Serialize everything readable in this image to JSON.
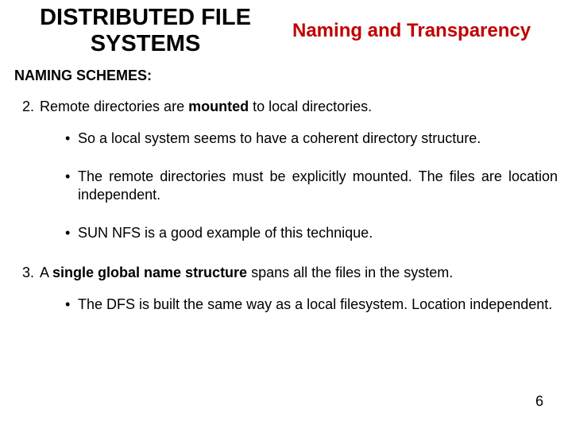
{
  "header": {
    "title_left_line1": "DISTRIBUTED FILE",
    "title_left_line2": "SYSTEMS",
    "title_right": "Naming and Transparency"
  },
  "section_heading": "NAMING SCHEMES:",
  "item2": {
    "num": "2.",
    "pre": "Remote directories are ",
    "bold": "mounted",
    "post": " to local directories."
  },
  "item2_bullets": {
    "b1": "So a local system seems to have a coherent directory structure.",
    "b2": "The remote directories must be explicitly mounted. The files are location independent.",
    "b3": "SUN NFS is a good example of this technique."
  },
  "item3": {
    "num": "3.",
    "pre": "A ",
    "bold": "single global name structure",
    "post": " spans all the files in the system."
  },
  "item3_bullets": {
    "b1": "The DFS is built the same way as a local filesystem. Location independent."
  },
  "page_number": "6"
}
